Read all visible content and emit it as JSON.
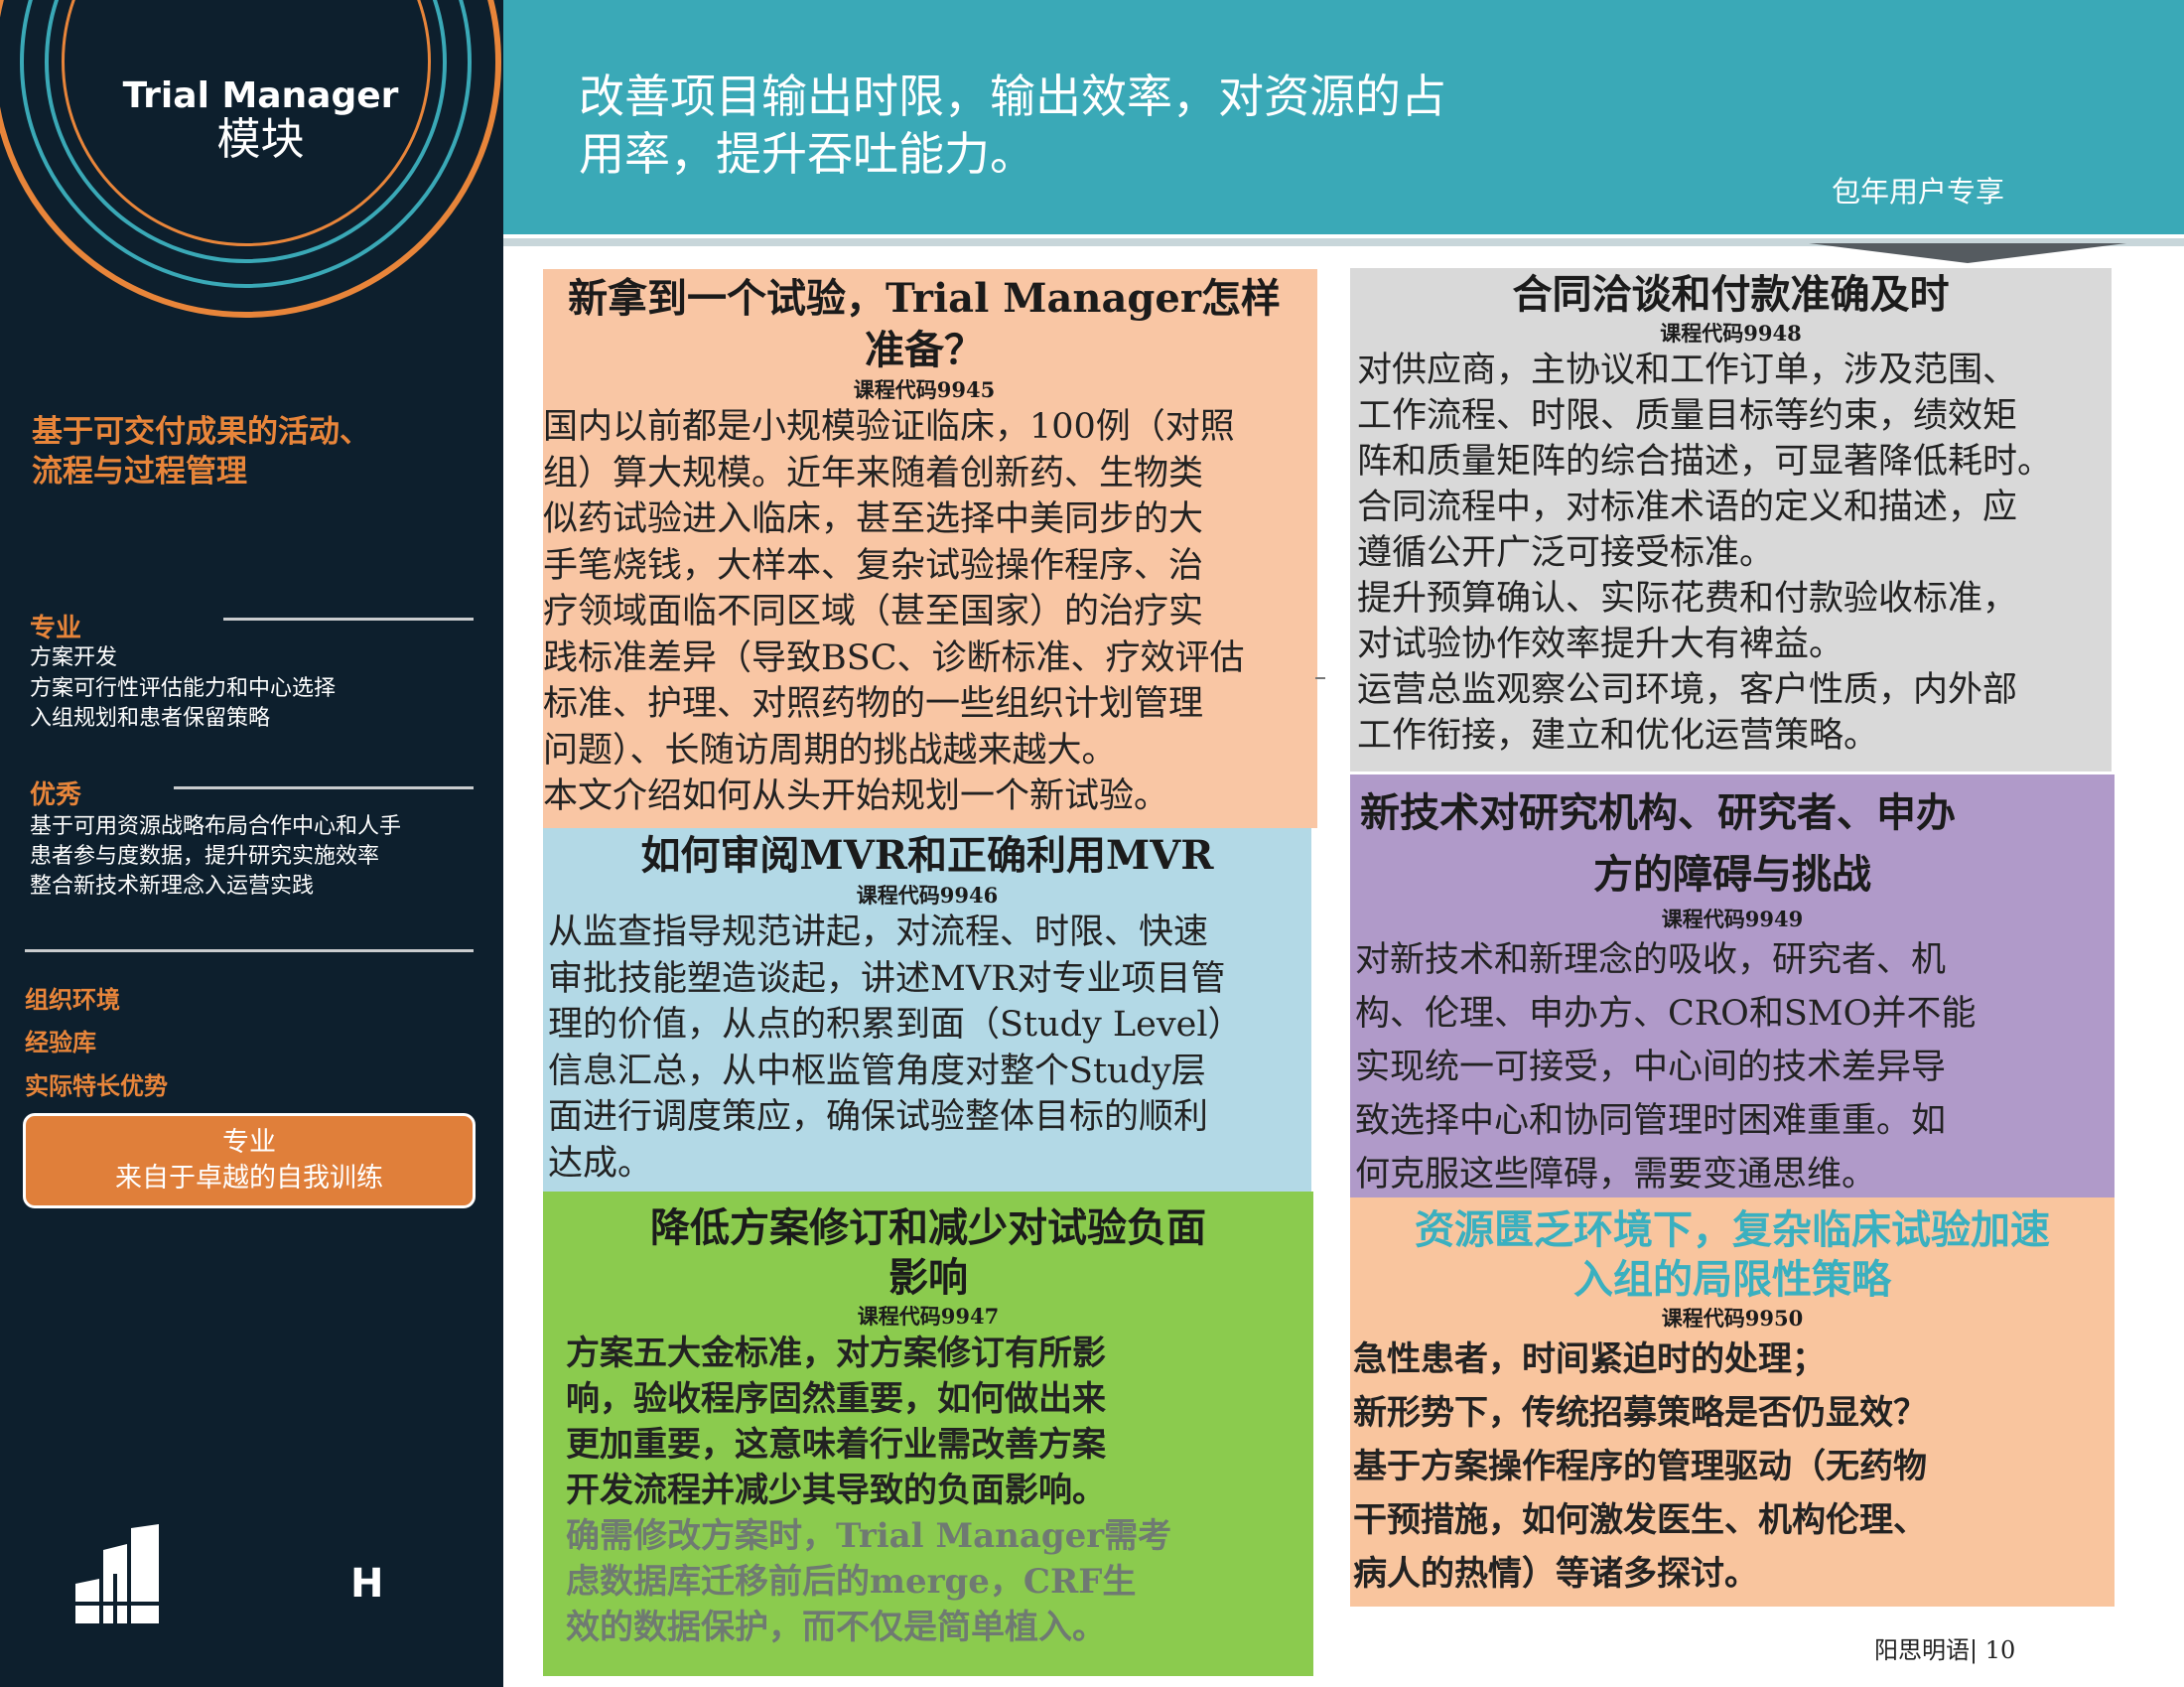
{
  "sidebar": {
    "module_title": "Trial Manager",
    "module_subtitle": "模块",
    "heading_lines": [
      "基于可交付成果的活动、",
      "流程与过程管理"
    ],
    "sections": [
      {
        "label": "专业",
        "items": [
          "方案开发",
          "方案可行性评估能力和中心选择",
          "入组规划和患者保留策略"
        ]
      },
      {
        "label": "优秀",
        "items": [
          "基于可用资源战略布局合作中心和人手",
          "患者参与度数据，提升研究实施效率",
          "整合新技术新理念入运营实践"
        ]
      }
    ],
    "org_items": [
      "组织环境",
      "经验库",
      "实际特长优势"
    ],
    "button_lines": [
      "专业",
      "来自于卓越的自我训练"
    ],
    "logo_letter": "H",
    "colors": {
      "bg": "#0d1f2d",
      "accent": "#e8853a"
    }
  },
  "header": {
    "title_lines": [
      "改善项目输出时限，输出效率，对资源的占",
      "用率，提升吞吐能力。"
    ],
    "subscriber_label": "包年用户专享",
    "color": "#3aa9b7"
  },
  "cards": [
    {
      "id": "9945",
      "title_lines": [
        "新拿到一个试验，Trial Manager怎样",
        "准备？"
      ],
      "code": "课程代码9945",
      "body_lines": [
        "国内以前都是小规模验证临床，100例（对照",
        "组）算大规模。近年来随着创新药、生物类",
        "似药试验进入临床，甚至选择中美同步的大",
        "手笔烧钱，大样本、复杂试验操作程序、治",
        "疗领域面临不同区域（甚至国家）的治疗实",
        "践标准差异（导致BSC、诊断标准、疗效评估",
        "标准、护理、对照药物的一些组织计划管理",
        "问题）、长随访周期的挑战越来越大。",
        "本文介绍如何从头开始规划一个新试验。"
      ],
      "color": "#f9c6a4"
    },
    {
      "id": "9946",
      "title_lines": [
        "如何审阅MVR和正确利用MVR"
      ],
      "code": "课程代码9946",
      "body_lines": [
        "从监查指导规范讲起，对流程、时限、快速",
        "审批技能塑造谈起，讲述MVR对专业项目管",
        "理的价值，从点的积累到面（Study Level）",
        "信息汇总，从中枢监管角度对整个Study层",
        "面进行调度策应，确保试验整体目标的顺利",
        "达成。"
      ],
      "color": "#b3d9e6"
    },
    {
      "id": "9947",
      "title_lines": [
        "降低方案修订和减少对试验负面",
        "影响"
      ],
      "code": "课程代码9947",
      "body_lines": [
        "方案五大金标准，对方案修订有所影",
        "响，验收程序固然重要，如何做出来",
        "更加重要，这意味着行业需改善方案",
        "开发流程并减少其导致的负面影响。"
      ],
      "muted_lines": [
        "确需修改方案时，Trial Manager需考",
        "虑数据库迁移前后的merge，CRF生",
        "效的数据保护，而不仅是简单植入。"
      ],
      "color": "#8bcb4e"
    },
    {
      "id": "9948",
      "title_lines": [
        "合同洽谈和付款准确及时"
      ],
      "code": "课程代码9948",
      "body_lines": [
        "对供应商，主协议和工作订单，涉及范围、",
        "工作流程、时限、质量目标等约束，绩效矩",
        "阵和质量矩阵的综合描述，可显著降低耗时。",
        "合同流程中，对标准术语的定义和描述，应",
        "遵循公开广泛可接受标准。",
        "提升预算确认、实际花费和付款验收标准，",
        "对试验协作效率提升大有裨益。",
        "运营总监观察公司环境，客户性质，内外部",
        "工作衔接，建立和优化运营策略。"
      ],
      "color": "#d9d9d9"
    },
    {
      "id": "9949",
      "title_lines": [
        "新技术对研究机构、研究者、申办",
        "方的障碍与挑战"
      ],
      "code": "课程代码9949",
      "body_lines": [
        "对新技术和新理念的吸收，研究者、机",
        "构、伦理、申办方、CRO和SMO并不能",
        "实现统一可接受，中心间的技术差异导",
        "致选择中心和协同管理时困难重重。如",
        "何克服这些障碍，需要变通思维。"
      ],
      "color": "#b09ac9"
    },
    {
      "id": "9950",
      "title_lines": [
        "资源匮乏环境下，复杂临床试验加速",
        "入组的局限性策略"
      ],
      "code": "课程代码9950",
      "body_lines": [
        "急性患者，时间紧迫时的处理；",
        "新形势下，传统招募策略是否仍显效？",
        "基于方案操作程序的管理驱动（无药物",
        "干预措施，如何激发医生、机构伦理、",
        "病人的热情）等诸多探讨。"
      ],
      "title_color": "#3ab0c0",
      "color": "#f9c59e"
    }
  ],
  "footer": {
    "text": "阳思明语| 10"
  }
}
